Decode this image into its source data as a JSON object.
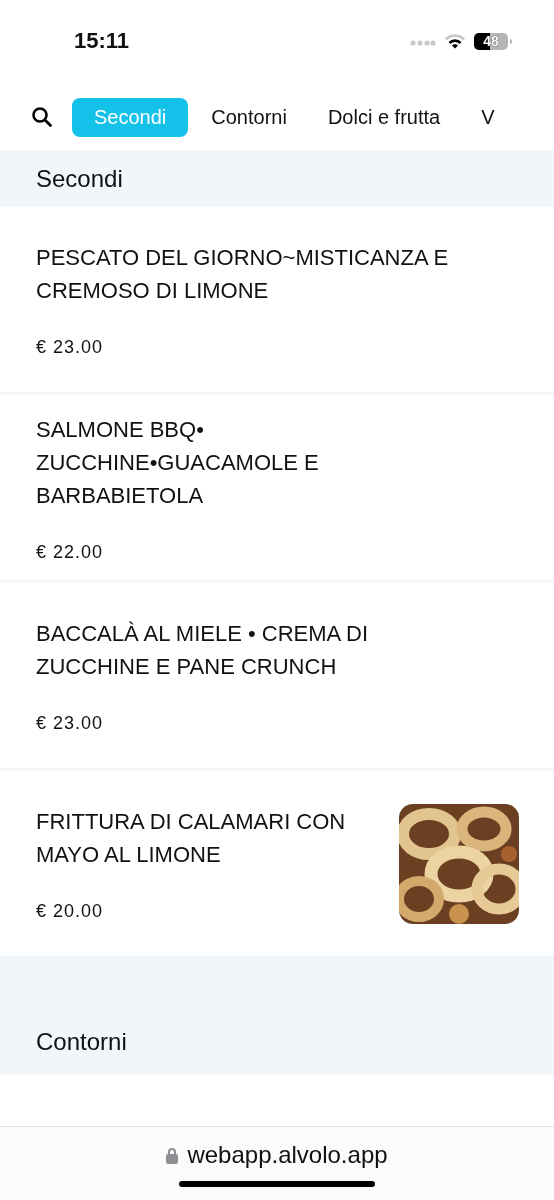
{
  "status_bar": {
    "time": "15:11",
    "battery": "48"
  },
  "tabs": [
    {
      "label": "Secondi",
      "selected": true
    },
    {
      "label": "Contorni",
      "selected": false
    },
    {
      "label": "Dolci e frutta",
      "selected": false
    },
    {
      "label": "V",
      "selected": false
    }
  ],
  "sections": [
    {
      "title": "Secondi",
      "items": [
        {
          "name": "PESCATO DEL GIORNO~MISTICANZA E CREMOSO DI LIMONE",
          "price": "€ 23.00"
        },
        {
          "name": "SALMONE BBQ• ZUCCHINE•GUACAMOLE E BARBABIETOLA",
          "price": "€ 22.00"
        },
        {
          "name": "BACCALÀ AL MIELE • CREMA DI ZUCCHINE E PANE CRUNCH",
          "price": "€ 23.00"
        },
        {
          "name": "FRITTURA DI CALAMARI CON MAYO AL LIMONE",
          "price": "€ 20.00"
        }
      ]
    },
    {
      "title": "Contorni"
    }
  ],
  "browser": {
    "url": "webapp.alvolo.app"
  }
}
